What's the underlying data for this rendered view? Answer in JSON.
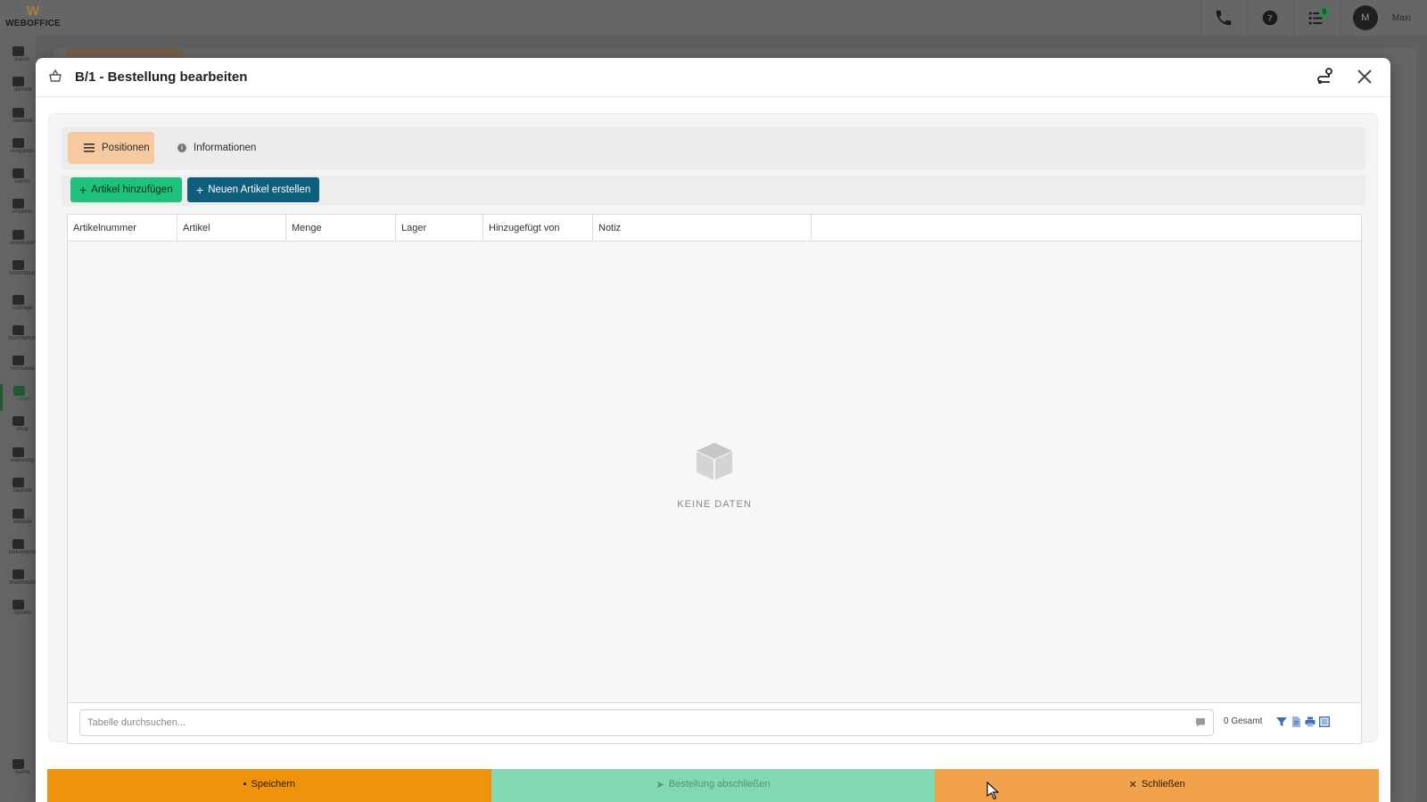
{
  "app": {
    "logo_text": "WEBOFFICE",
    "logo_mark": "W"
  },
  "topbar": {
    "icons": [
      "phone-icon",
      "help-icon",
      "tasks-icon"
    ],
    "tasks_badge": "0",
    "user": {
      "initial": "M",
      "name": "Maxi"
    }
  },
  "sidebar": {
    "items": [
      {
        "label": "Kasse"
      },
      {
        "label": "Termine"
      },
      {
        "label": "Telefonie"
      },
      {
        "label": "Aufgaben"
      },
      {
        "label": "Gastro"
      },
      {
        "label": "Projekte"
      },
      {
        "label": "Arbeitszeit"
      },
      {
        "label": "Schichtplanung"
      },
      {
        "label": "Aufträge"
      },
      {
        "label": "Buchhaltung"
      },
      {
        "label": "Formulare"
      },
      {
        "label": "Lager"
      },
      {
        "label": "Shop"
      },
      {
        "label": "Marketing"
      },
      {
        "label": "Statistik"
      },
      {
        "label": "Website"
      },
      {
        "label": "Dokumente"
      },
      {
        "label": "Stammdaten"
      },
      {
        "label": "System"
      }
    ],
    "search_label": "Suche"
  },
  "modal": {
    "title": "B/1 - Bestellung bearbeiten",
    "tabs": [
      {
        "label": "Positionen"
      },
      {
        "label": "Informationen"
      }
    ],
    "toolbar": {
      "add_article": "Artikel hinzufügen",
      "new_article": "Neuen Artikel erstellen"
    },
    "table": {
      "columns": [
        "Artikelnummer",
        "Artikel",
        "Menge",
        "Lager",
        "Hinzugefügt von",
        "Notiz",
        ""
      ],
      "rows": [],
      "empty_text": "KEINE DATEN"
    },
    "search_placeholder": "Tabelle durchsuchen...",
    "total_text": "0 Gesamt",
    "footer": {
      "save": "Speichern",
      "finish": "Bestellung abschließen",
      "close": "Schließen"
    }
  },
  "colors": {
    "green_button": "#1ec27a",
    "blue_button": "#0f5e7c",
    "active_tab": "#f6c9a0",
    "save": "#ef920c",
    "finish": "#80d9b3",
    "close": "#f2a24a"
  }
}
